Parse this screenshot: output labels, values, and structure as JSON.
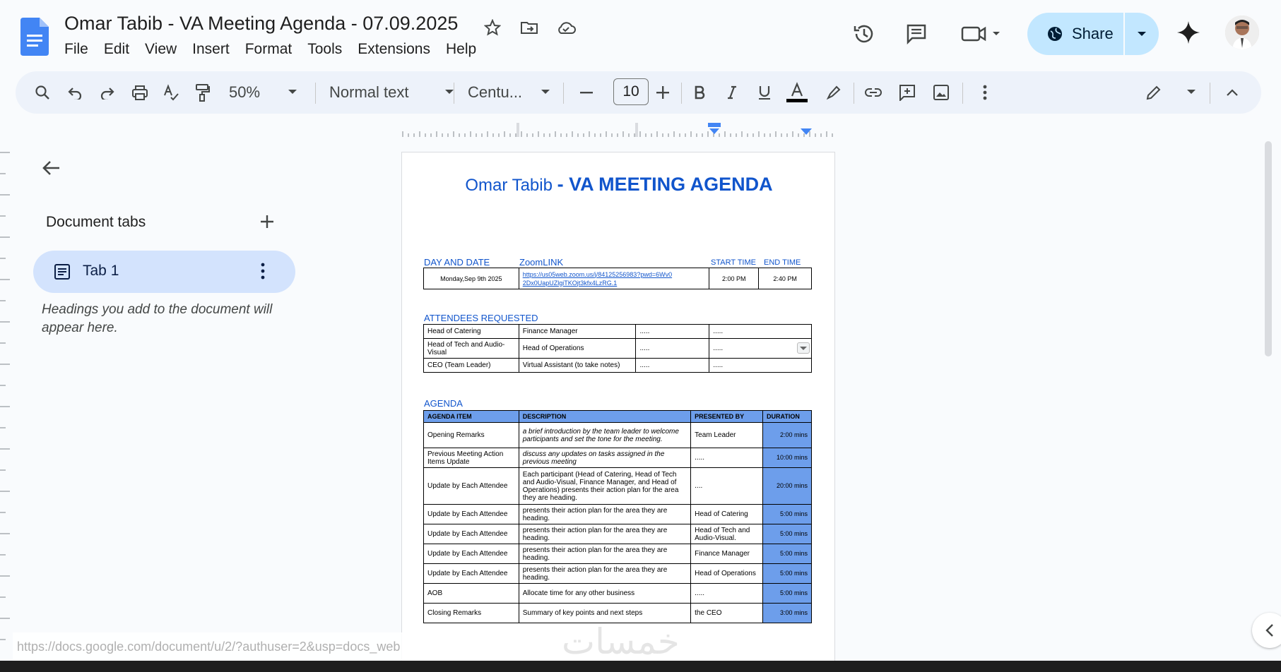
{
  "app": {
    "title": "Omar Tabib - VA Meeting Agenda  - 07.09.2025",
    "menu": [
      "File",
      "Edit",
      "View",
      "Insert",
      "Format",
      "Tools",
      "Extensions",
      "Help"
    ],
    "share_label": "Share"
  },
  "toolbar": {
    "zoom": "50%",
    "style": "Normal text",
    "font": "Centu...",
    "font_size": "10"
  },
  "panel": {
    "heading": "Document tabs",
    "tab_label": "Tab 1",
    "hint": "Headings you add to the document will appear here."
  },
  "doc": {
    "title_name": "Omar Tabib ",
    "title_main": "- VA MEETING AGENDA",
    "labels": {
      "day_date": "DAY AND DATE",
      "zoomlink": "ZoomLINK",
      "start": "START TIME",
      "end": "END TIME",
      "attendees": "ATTENDEES REQUESTED",
      "agenda": "AGENDA"
    },
    "meeting": {
      "date": "Monday,Sep 9th 2025",
      "link": "https://us05web.zoom.us/j/84125256983?pwd=6Wv0 2Dx0UapUZlgiTKOjt3kfx4LzRG.1",
      "start": "2:00 PM",
      "end": "2:40 PM"
    },
    "attendees": [
      [
        "Head of Catering",
        "Finance Manager",
        ".....",
        "....."
      ],
      [
        "Head of Tech and Audio-Visual",
        "Head of Operations",
        ".....",
        "....."
      ],
      [
        "CEO (Team Leader)",
        "Virtual Assistant (to take notes)",
        ".....",
        "....."
      ]
    ],
    "agenda_headers": [
      "AGENDA ITEM",
      "DESCRIPTION",
      "PRESENTED BY",
      "DURATION"
    ],
    "agenda": [
      [
        "Opening Remarks",
        "a brief introduction by the team leader to welcome participants and set the tone for the meeting.",
        "Team Leader",
        "2:00 mins"
      ],
      [
        "Previous Meeting Action Items Update",
        "discuss any updates on tasks assigned in the previous meeting",
        ".....",
        "10:00 mins"
      ],
      [
        "Update by Each Attendee",
        "Each participant (Head of Catering, Head of Tech and Audio-Visual, Finance Manager, and Head of Operations) presents their action plan for the area they are heading.",
        "....",
        "20:00 mins"
      ],
      [
        "Update by Each Attendee",
        "presents their action plan for the area they are heading.",
        "Head of Catering",
        "5:00 mins"
      ],
      [
        "Update by Each Attendee",
        "presents their action plan for the area they are heading.",
        "Head of Tech and Audio-Visual.",
        "5:00 mins"
      ],
      [
        "Update by Each Attendee",
        "presents their action plan for the area they are heading.",
        "Finance Manager",
        "5:00 mins"
      ],
      [
        "Update by Each Attendee",
        "presents their action plan for the area they are heading.",
        "Head of Operations",
        "5:00 mins"
      ],
      [
        "AOB",
        "Allocate time for any other business",
        ".....",
        "5:00 mins"
      ],
      [
        "Closing Remarks",
        "Summary of key points and next steps",
        "the CEO",
        "3:00 mins"
      ]
    ]
  },
  "status_url": "https://docs.google.com/document/u/2/?authuser=2&usp=docs_web",
  "watermark": "خمسات",
  "colors": {
    "accent": "#1155cc",
    "table_header": "#6d9eeb",
    "share_bg": "#c2e7ff",
    "tab_bg": "#d3e3fd"
  }
}
